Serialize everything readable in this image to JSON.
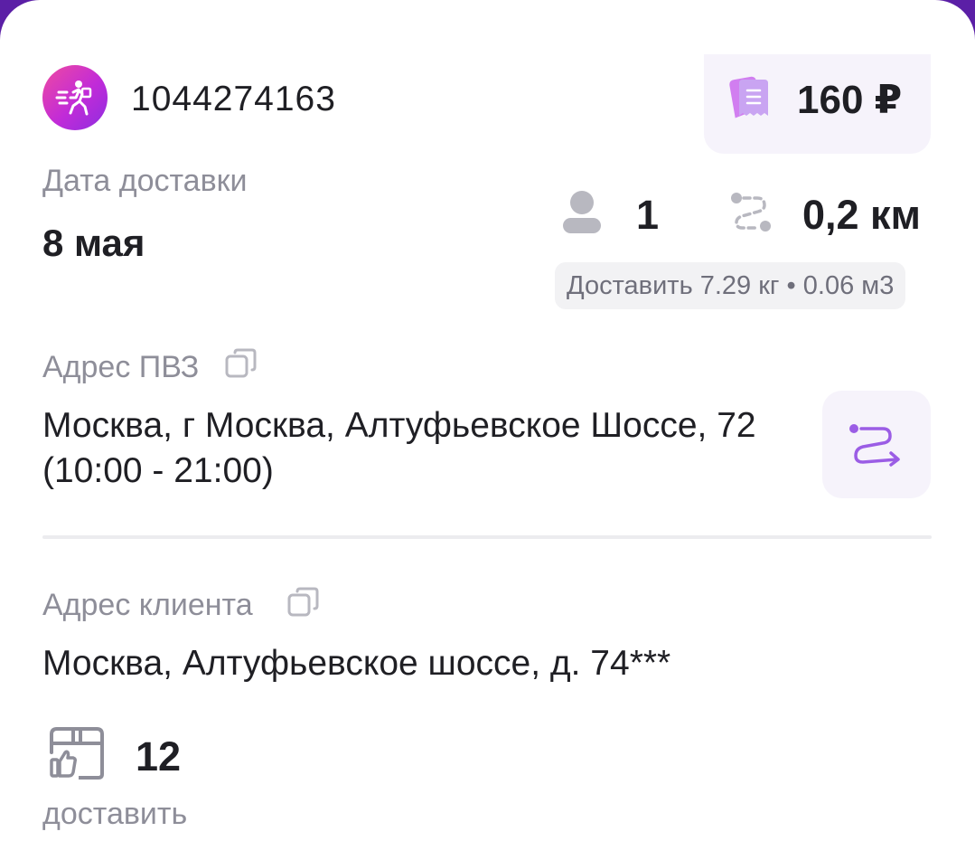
{
  "order": {
    "id": "1044274163",
    "price": "160 ₽",
    "icons": {
      "courier": "courier-running-icon",
      "receipt": "receipt-icon"
    }
  },
  "delivery": {
    "date_label": "Дата доставки",
    "date_value": "8 мая",
    "clients_count": "1",
    "distance": "0,2 км",
    "weight_volume": "Доставить 7.29 кг • 0.06 м3",
    "icons": {
      "clients": "person-icon",
      "distance": "route-icon"
    }
  },
  "pvz": {
    "label": "Адрес ПВЗ",
    "address": "Москва, г Москва, Алтуфьевское Шоссе, 72 (10:00 - 21:00)",
    "copy_icon": "copy-icon",
    "navigate_icon": "navigation-route-icon"
  },
  "client": {
    "label": "Адрес клиента",
    "address": "Москва, Алтуфьевское шоссе, д. 74***",
    "copy_icon": "copy-icon"
  },
  "items": {
    "count": "12",
    "caption": "доставить",
    "icon": "box-thumbs-up-icon"
  },
  "colors": {
    "accent_purple": "#9b5de5",
    "header_background": "#5b1fa6",
    "text_primary": "#1f1f24",
    "text_secondary": "#8e8e99",
    "icon_grey": "#b8b8c0"
  }
}
